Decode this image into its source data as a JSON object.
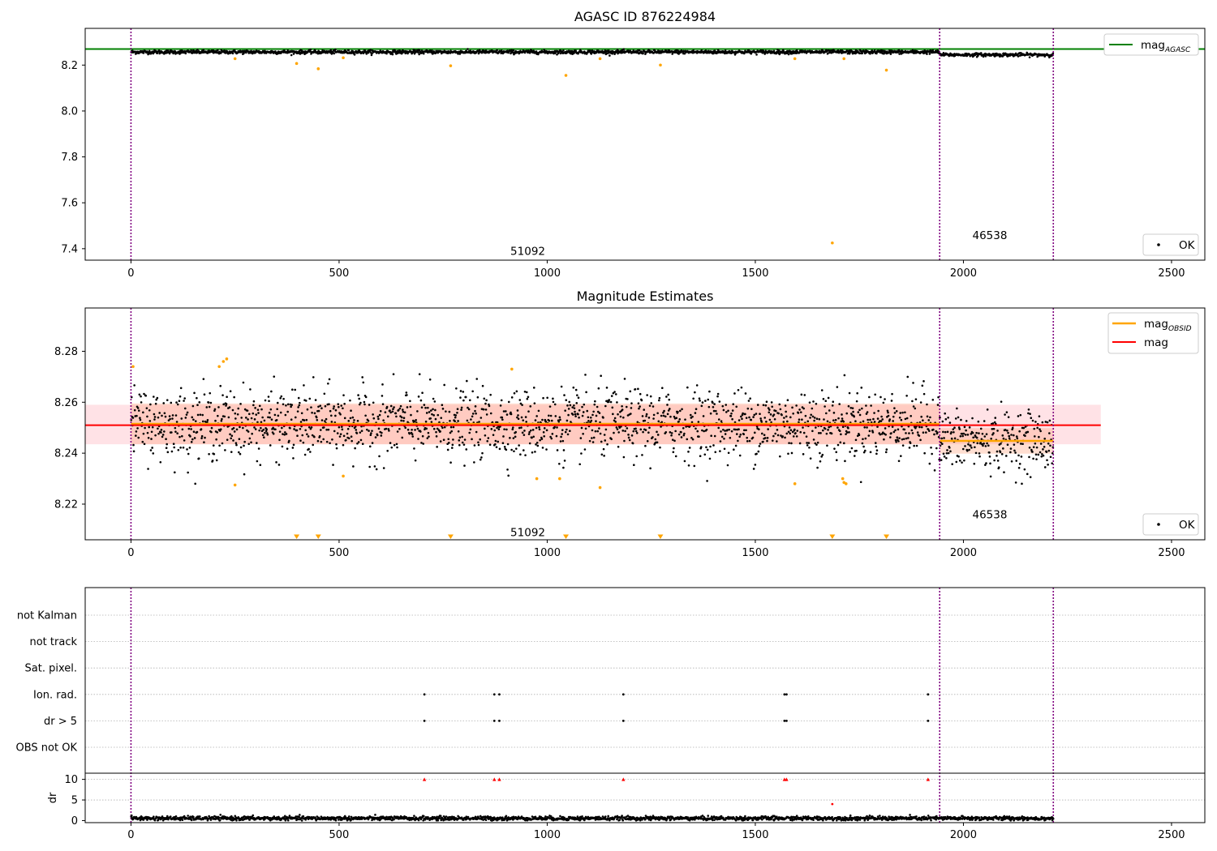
{
  "colors": {
    "agasc_line": "#008000",
    "obsid_mag": "#ffa500",
    "mag_line": "#ff0000",
    "band_fill": "#ffb6c1",
    "obs_band_fill": "#ffa07a",
    "ok_points": "#000000",
    "outlier_points": "#ffa500",
    "dr_flag": "#ff0000",
    "obs_separator": "#800080"
  },
  "chart_data": [
    {
      "type": "scatter",
      "title": "AGASC ID 876224984",
      "xlim": [
        -110,
        2580
      ],
      "ylim": [
        7.35,
        8.36
      ],
      "xticks": [
        0,
        500,
        1000,
        1500,
        2000,
        2500
      ],
      "yticks": [
        7.4,
        7.6,
        7.8,
        8.0,
        8.2
      ],
      "tick_labels_y": [
        "7.4",
        "7.6",
        "7.8",
        "8.0",
        "8.2"
      ],
      "tick_labels_x": [
        "0",
        "500",
        "1000",
        "1500",
        "2000",
        "2500"
      ],
      "agasc_mag": 8.27,
      "obs_boundaries": [
        0,
        1943,
        2216
      ],
      "obs_labels": [
        {
          "text": "51092",
          "x": 970,
          "y": 7.39
        },
        {
          "text": "46538",
          "x": 2080,
          "y": 7.46
        }
      ],
      "ok_series": {
        "segments": [
          {
            "x0": 0,
            "x1": 1943,
            "mean": 8.257,
            "spread": 0.0065
          },
          {
            "x0": 1943,
            "x1": 2216,
            "mean": 8.245,
            "spread": 0.006
          }
        ],
        "count": 2216
      },
      "outliers": [
        {
          "x": 250,
          "y": 8.228
        },
        {
          "x": 398,
          "y": 8.207
        },
        {
          "x": 450,
          "y": 8.184
        },
        {
          "x": 510,
          "y": 8.232
        },
        {
          "x": 768,
          "y": 8.197
        },
        {
          "x": 1045,
          "y": 8.155
        },
        {
          "x": 1127,
          "y": 8.228
        },
        {
          "x": 1272,
          "y": 8.2
        },
        {
          "x": 1595,
          "y": 8.228
        },
        {
          "x": 1685,
          "y": 7.425
        },
        {
          "x": 1713,
          "y": 8.228
        },
        {
          "x": 1815,
          "y": 8.178
        }
      ],
      "legend": {
        "line_label": "mag",
        "line_label_sub": "AGASC",
        "points_label": "OK"
      }
    },
    {
      "type": "scatter",
      "title": "Magnitude Estimates",
      "xlim": [
        -110,
        2580
      ],
      "ylim": [
        8.206,
        8.297
      ],
      "xticks": [
        0,
        500,
        1000,
        1500,
        2000,
        2500
      ],
      "yticks": [
        8.22,
        8.24,
        8.26,
        8.28
      ],
      "tick_labels_y": [
        "8.22",
        "8.24",
        "8.26",
        "8.28"
      ],
      "tick_labels_x": [
        "0",
        "500",
        "1000",
        "1500",
        "2000",
        "2500"
      ],
      "obs_boundaries": [
        0,
        1943,
        2216
      ],
      "obs_labels": [
        {
          "text": "51092",
          "x": 970,
          "y": 8.209
        },
        {
          "text": "46538",
          "x": 2080,
          "y": 8.216
        }
      ],
      "mag": {
        "value": 8.251,
        "band": [
          8.2435,
          8.259
        ],
        "x_range": [
          -110,
          2330
        ]
      },
      "mag_obsid": [
        {
          "x0": 0,
          "x1": 1943,
          "value": 8.2515,
          "band": [
            8.2435,
            8.2595
          ]
        },
        {
          "x0": 1943,
          "x1": 2216,
          "value": 8.2448,
          "band": [
            8.2398,
            8.2498
          ]
        }
      ],
      "ok_series": {
        "segments": [
          {
            "x0": 0,
            "x1": 1943,
            "mean": 8.2515,
            "spread": 0.0075
          },
          {
            "x0": 1943,
            "x1": 2216,
            "mean": 8.2448,
            "spread": 0.0065
          }
        ],
        "count": 2216
      },
      "outliers": [
        {
          "x": 5,
          "y": 8.274
        },
        {
          "x": 212,
          "y": 8.274
        },
        {
          "x": 222,
          "y": 8.276
        },
        {
          "x": 230,
          "y": 8.277
        },
        {
          "x": 250,
          "y": 8.2275
        },
        {
          "x": 510,
          "y": 8.231
        },
        {
          "x": 915,
          "y": 8.273
        },
        {
          "x": 975,
          "y": 8.23
        },
        {
          "x": 1030,
          "y": 8.23
        },
        {
          "x": 1127,
          "y": 8.2265
        },
        {
          "x": 1595,
          "y": 8.228
        },
        {
          "x": 1710,
          "y": 8.23
        },
        {
          "x": 1713,
          "y": 8.2285
        },
        {
          "x": 1718,
          "y": 8.228
        }
      ],
      "off_scale_markers": [
        398,
        450,
        768,
        1045,
        1272,
        1685,
        1815
      ],
      "legend": {
        "obsid_label": "mag",
        "obsid_label_sub": "OBSID",
        "mag_label": "mag",
        "points_label": "OK"
      }
    },
    {
      "type": "scatter",
      "title": "",
      "xlim": [
        -110,
        2580
      ],
      "xticks": [
        0,
        500,
        1000,
        1500,
        2000,
        2500
      ],
      "tick_labels_x": [
        "0",
        "500",
        "1000",
        "1500",
        "2000",
        "2500"
      ],
      "flag_rows": [
        "not Kalman",
        "not track",
        "Sat. pixel.",
        "Ion. rad.",
        "dr > 5",
        "OBS not OK"
      ],
      "flag_points": {
        "Ion. rad.": [
          705,
          873,
          885,
          1183,
          1570,
          1575,
          1915
        ],
        "dr > 5": [
          705,
          873,
          885,
          1183,
          1570,
          1575,
          1915
        ]
      },
      "obs_boundaries": [
        0,
        1943,
        2216
      ],
      "dr": {
        "ylabel": "dr",
        "ylim": [
          -0.5,
          11.5
        ],
        "yticks": [
          0,
          5,
          10
        ],
        "tick_labels_y": [
          "0",
          "5",
          "10"
        ],
        "clipped_value": 10,
        "clipped_x": [
          705,
          873,
          885,
          1183,
          1570,
          1575,
          1915
        ],
        "isolated_points": [
          {
            "x": 1685,
            "y": 4.0
          }
        ],
        "baseline_mean": 0.55,
        "baseline_spread": 0.25
      }
    }
  ]
}
